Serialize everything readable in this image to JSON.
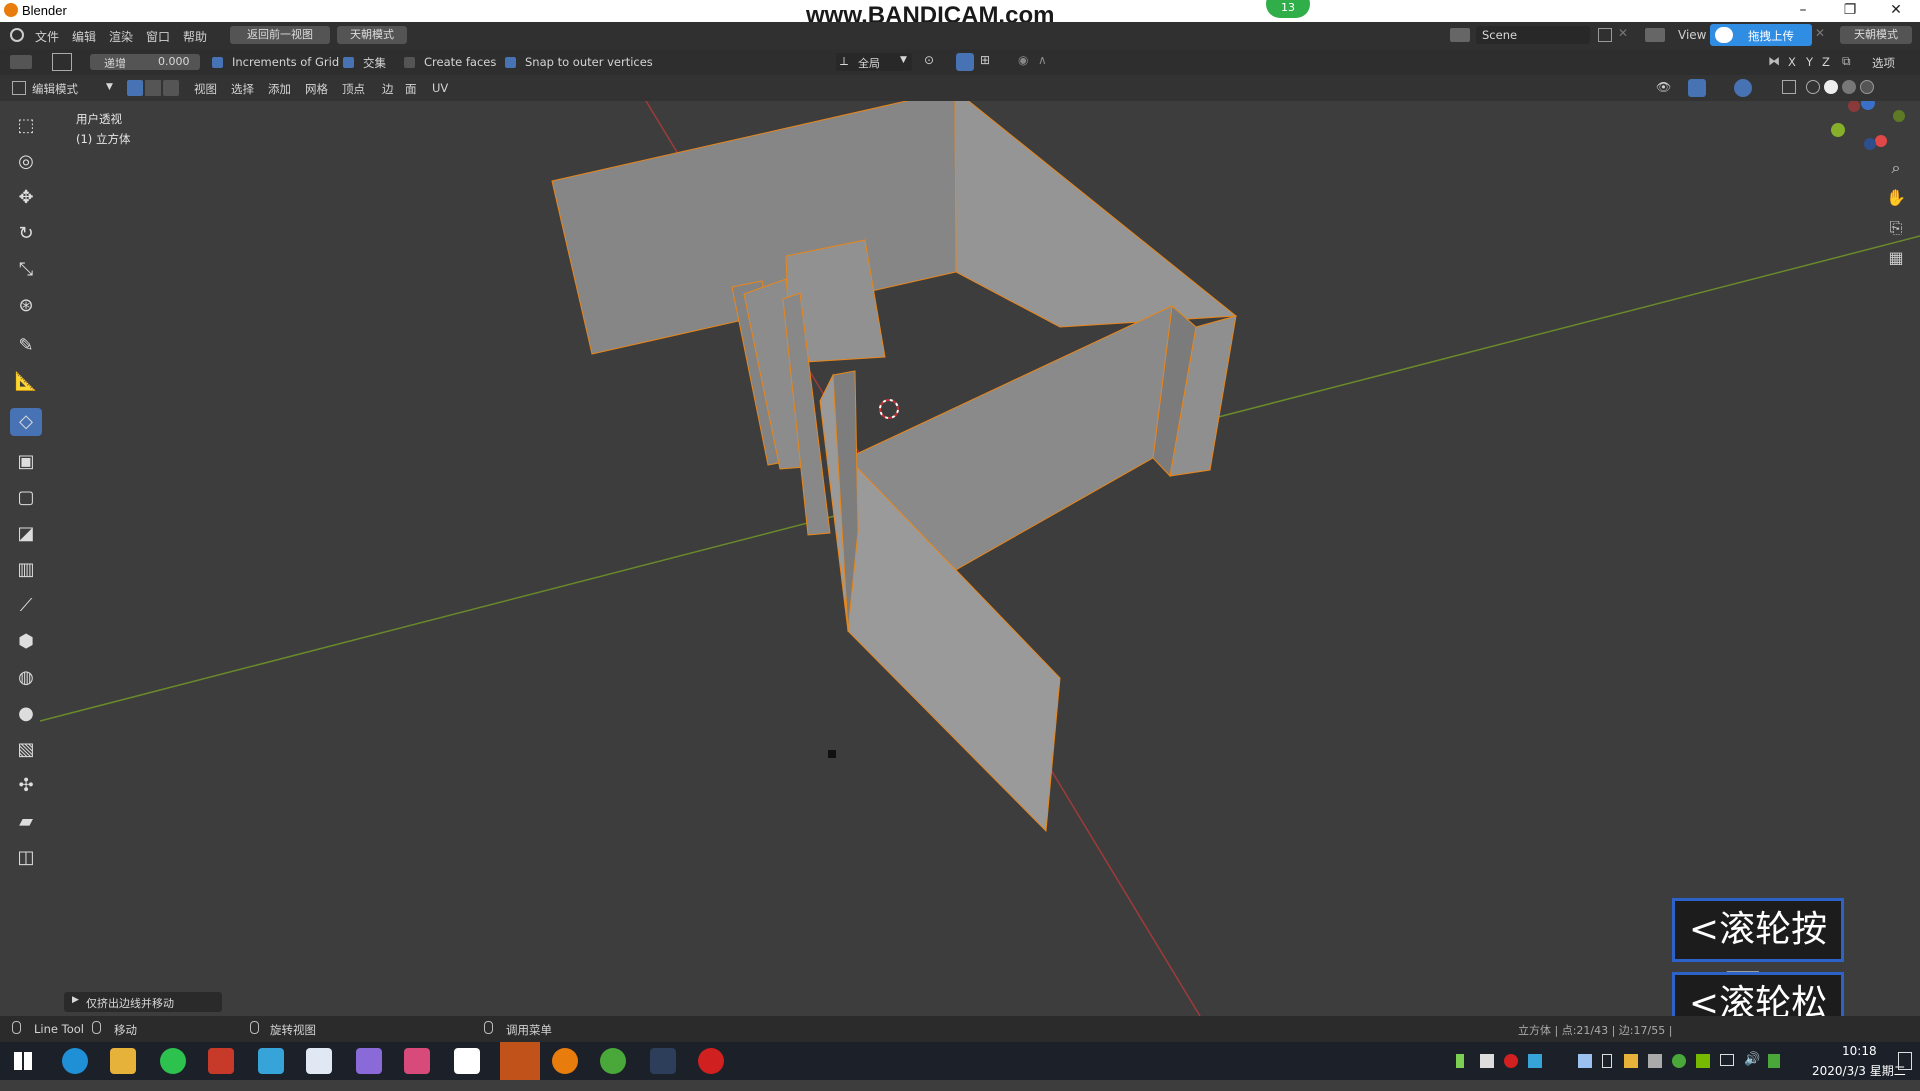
{
  "window": {
    "title": "Blender",
    "watermark": "www.BANDICAM.com",
    "badge": "13"
  },
  "menu": {
    "items": [
      "文件",
      "编辑",
      "渲染",
      "窗口",
      "帮助"
    ],
    "back_button": "返回前一视图",
    "mode_button": "天朝模式",
    "scene_label": "Scene",
    "view_label": "View",
    "upload_button": "拖拽上传",
    "right_mode_button": "天朝模式"
  },
  "tool_header": {
    "increment_label": "递增",
    "increment_value": "0.000",
    "increments_of_grid": "Increments of Grid",
    "intersect": "交集",
    "create_faces": "Create faces",
    "snap_outer": "Snap to outer vertices",
    "orientation": "全局",
    "options": "选项",
    "axes": [
      "X",
      "Y",
      "Z"
    ]
  },
  "editor_header": {
    "mode": "编辑模式",
    "items": [
      "视图",
      "选择",
      "添加",
      "网格",
      "顶点",
      "边",
      "面",
      "UV"
    ]
  },
  "viewport": {
    "view_name": "用户透视",
    "object_name": "(1) 立方体",
    "operator_panel": "仅挤出边线并移动"
  },
  "overlays": {
    "wheel_down": "<滚轮按下>",
    "wheel_up": "<滚轮松开>"
  },
  "statusbar": {
    "line_tool": "Line Tool",
    "move": "移动",
    "rotate_view": "旋转视图",
    "call_menu": "调用菜单",
    "stats": "立方体 | 点:21/43 | 边:17/55 |"
  },
  "taskbar": {
    "time": "10:18",
    "date": "2020/3/3 星期二"
  },
  "colors": {
    "accent": "#4772b3",
    "selected_edge": "#e8861a",
    "x_axis": "#b03a3a",
    "y_axis": "#6a8a2a",
    "mesh_face": "#8a8a8a"
  }
}
